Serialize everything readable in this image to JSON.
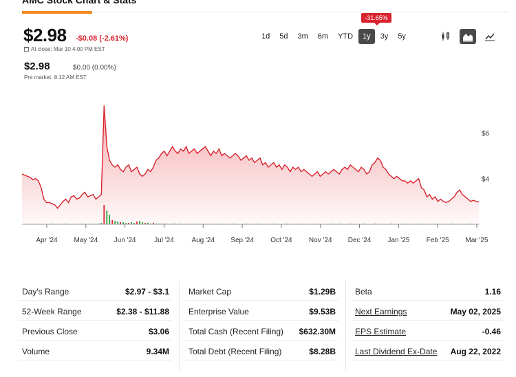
{
  "page": {
    "heading": "AMC Stock Chart & Stats"
  },
  "quote": {
    "price": "$2.98",
    "change": "-$0.08 (-2.61%)",
    "close_time": "At close: Mar 10 4:00 PM EST",
    "pre_price": "$2.98",
    "pre_change": "$0.00 (0.00%)",
    "pre_time": "Pre market: 8:12 AM EST"
  },
  "range": {
    "options": [
      "1d",
      "5d",
      "3m",
      "6m",
      "YTD",
      "1y",
      "3y",
      "5y"
    ],
    "selected": "1y",
    "badge": "-31.65%"
  },
  "chart_types": [
    {
      "icon": "candlestick-icon",
      "active": false
    },
    {
      "icon": "area-chart-icon",
      "active": true
    },
    {
      "icon": "line-chart-icon",
      "active": false
    }
  ],
  "colors": {
    "accent": "#f08c1e",
    "down": "#d9232e",
    "line": "#d9232e",
    "volume_up": "#2e9e3a"
  },
  "chart_data": {
    "type": "area",
    "x_labels": [
      "Apr '24",
      "May '24",
      "Jun '24",
      "Jul '24",
      "Aug '24",
      "Sep '24",
      "Oct '24",
      "Nov '24",
      "Dec '24",
      "Jan '25",
      "Feb '25",
      "Mar '25"
    ],
    "y_ticks": [
      "$6",
      "$4"
    ],
    "y_tick_values": [
      6,
      4
    ],
    "ylim": [
      2.0,
      7.6
    ],
    "values": [
      4.2,
      4.15,
      4.1,
      4.05,
      3.95,
      4.0,
      3.9,
      3.6,
      3.1,
      2.95,
      2.95,
      2.9,
      2.85,
      2.7,
      2.85,
      3.0,
      3.1,
      2.95,
      3.2,
      3.25,
      3.1,
      3.15,
      3.3,
      3.4,
      3.2,
      3.25,
      3.3,
      3.1,
      3.2,
      3.3,
      7.2,
      5.4,
      4.8,
      4.6,
      4.5,
      4.6,
      4.4,
      4.3,
      4.5,
      4.6,
      4.3,
      4.4,
      4.5,
      4.2,
      4.1,
      4.2,
      4.4,
      4.3,
      4.5,
      4.8,
      4.9,
      5.1,
      5.2,
      5.0,
      5.2,
      5.4,
      5.2,
      5.1,
      5.3,
      5.2,
      5.4,
      5.1,
      5.2,
      5.3,
      5.1,
      5.2,
      5.3,
      5.4,
      5.2,
      5.0,
      5.2,
      5.1,
      5.3,
      5.0,
      5.1,
      5.0,
      4.9,
      5.0,
      5.1,
      5.0,
      4.8,
      4.9,
      5.0,
      4.8,
      4.9,
      4.7,
      4.8,
      4.9,
      4.6,
      4.7,
      4.5,
      4.6,
      4.7,
      4.5,
      4.6,
      4.4,
      4.6,
      4.5,
      4.3,
      4.5,
      4.4,
      4.5,
      4.3,
      4.4,
      4.3,
      4.2,
      4.1,
      4.2,
      4.3,
      4.1,
      4.2,
      4.3,
      4.2,
      4.3,
      4.4,
      4.3,
      4.2,
      4.4,
      4.5,
      4.4,
      4.6,
      4.5,
      4.4,
      4.3,
      4.5,
      4.4,
      4.2,
      4.3,
      4.6,
      4.7,
      4.9,
      4.8,
      4.5,
      4.4,
      4.2,
      4.1,
      4.0,
      4.1,
      4.0,
      3.9,
      3.9,
      3.8,
      3.9,
      3.8,
      3.9,
      4.0,
      3.6,
      3.5,
      3.2,
      3.3,
      3.1,
      3.2,
      3.0,
      3.1,
      3.0,
      2.95,
      3.0,
      3.1,
      3.2,
      3.4,
      3.5,
      3.3,
      3.2,
      3.1,
      3.0,
      3.05,
      3.0,
      2.98
    ],
    "volume": [
      0,
      0,
      0,
      0,
      0,
      0,
      0,
      0,
      0,
      0,
      0,
      1,
      0,
      0,
      0,
      0,
      1,
      0,
      0,
      0,
      0,
      0,
      1,
      0,
      0,
      0,
      1,
      0,
      1,
      2,
      28,
      20,
      14,
      6,
      5,
      4,
      3,
      3,
      2,
      2,
      3,
      2,
      4,
      5,
      3,
      2,
      2,
      1,
      2,
      1,
      1,
      1,
      1,
      1,
      0,
      1,
      1,
      0,
      1,
      0,
      1,
      0,
      0,
      0,
      1,
      0,
      0,
      0,
      1,
      0,
      0,
      0,
      0,
      1,
      0,
      0,
      0,
      1,
      0,
      0,
      0,
      0,
      1,
      0,
      0,
      0,
      1,
      0,
      0,
      0,
      0,
      0,
      1,
      0,
      0,
      0,
      0,
      1,
      0,
      0,
      0,
      0,
      1,
      0,
      0,
      0,
      0,
      0,
      1,
      0,
      0,
      0,
      0,
      1,
      0,
      0,
      1,
      0,
      0,
      0,
      1,
      0,
      0,
      0,
      0,
      1,
      0,
      0,
      0,
      1,
      0,
      0,
      0,
      0,
      0,
      1,
      0,
      0,
      0,
      0,
      1,
      0,
      0,
      0,
      0,
      0,
      1,
      0,
      0,
      0,
      0,
      1,
      0,
      0,
      0,
      0,
      0,
      1,
      0,
      0,
      0,
      0,
      0,
      0,
      1,
      0,
      0,
      0,
      0,
      0
    ]
  },
  "stats": {
    "col1": [
      {
        "label": "Day's Range",
        "value": "$2.97 - $3.1"
      },
      {
        "label": "52-Week Range",
        "value": "$2.38 - $11.88"
      },
      {
        "label": "Previous Close",
        "value": "$3.06"
      },
      {
        "label": "Volume",
        "value": "9.34M"
      }
    ],
    "col2": [
      {
        "label": "Market Cap",
        "value": "$1.29B"
      },
      {
        "label": "Enterprise Value",
        "value": "$9.53B"
      },
      {
        "label": "Total Cash (Recent Filing)",
        "value": "$632.30M"
      },
      {
        "label": "Total Debt (Recent Filing)",
        "value": "$8.28B"
      }
    ],
    "col3": [
      {
        "label": "Beta",
        "value": "1.16"
      },
      {
        "label": "Next Earnings",
        "value": "May 02, 2025"
      },
      {
        "label": "EPS Estimate",
        "value": "-0.46"
      },
      {
        "label": "Last Dividend Ex-Date",
        "value": "Aug 22, 2022"
      }
    ]
  }
}
